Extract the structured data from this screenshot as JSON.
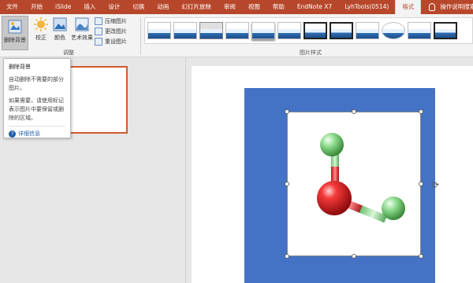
{
  "tabs": [
    "文件",
    "开始",
    "iSlide",
    "插入",
    "设计",
    "切换",
    "动画",
    "幻灯片放映",
    "审阅",
    "视图",
    "帮助",
    "EndNote X7",
    "LyhTools(0514)",
    "格式",
    "操作说明搜索"
  ],
  "active_tab": "格式",
  "ribbon": {
    "remove_bg": "删除背景",
    "correct": "校正",
    "color": "颜色",
    "art_effects": "艺术效果",
    "compress": "压缩图片",
    "change": "更改图片",
    "reset": "重设图片",
    "adjust_group": "调整",
    "styles_group": "图片样式"
  },
  "tooltip": {
    "title": "删除背景",
    "desc": "自动删除不需要的部分图片。",
    "note": "如果需要，请使用标记表示图片中要保留或删除的区域。",
    "more": "详细信息"
  },
  "colors": {
    "accent": "#b7472a",
    "picture_bg": "#4472c4",
    "oxygen": "#e0161b",
    "hydrogen": "#7ed07e"
  },
  "icons": [
    "remove-background-icon",
    "correct-icon",
    "color-icon",
    "art-effects-icon",
    "lightbulb-icon",
    "help-icon",
    "rotate-icon"
  ]
}
